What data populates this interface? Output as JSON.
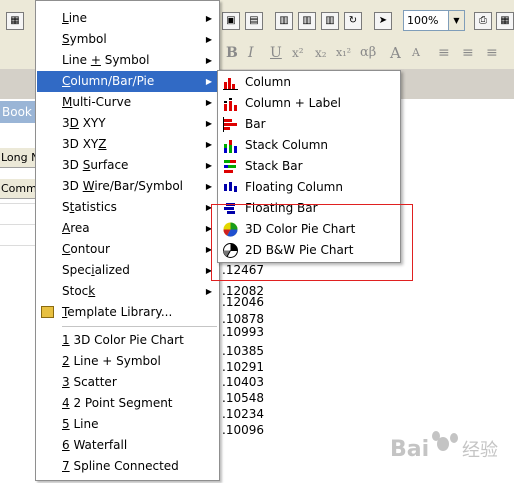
{
  "toolbar": {
    "zoom_value": "100%",
    "format_glyphs": [
      "B",
      "I",
      "U",
      "x²",
      "x₂",
      "x₁²",
      "αβ",
      "A",
      "A",
      "≡"
    ]
  },
  "worksheet": {
    "tab_label": "Book",
    "column_headers": [
      "Long N",
      "Comm"
    ],
    "cell_values": [
      ".12467",
      ".12082",
      ".12046",
      ".10878",
      ".10993",
      ".10385",
      ".10291",
      ".10403",
      ".10548",
      ".10234",
      ".10096"
    ]
  },
  "main_menu": {
    "items": [
      {
        "label": "Line",
        "mnemonic_index": 0,
        "has_submenu": true
      },
      {
        "label": "Symbol",
        "mnemonic_index": 0,
        "has_submenu": true
      },
      {
        "label": "Line + Symbol",
        "mnemonic_index": 5,
        "has_submenu": true
      },
      {
        "label": "Column/Bar/Pie",
        "mnemonic_index": 0,
        "has_submenu": true,
        "selected": true
      },
      {
        "label": "Multi-Curve",
        "mnemonic_index": 0,
        "has_submenu": true
      },
      {
        "label": "3D XYY",
        "mnemonic_index": 1,
        "has_submenu": true
      },
      {
        "label": "3D XYZ",
        "mnemonic_index": 5,
        "has_submenu": true
      },
      {
        "label": "3D Surface",
        "mnemonic_index": 3,
        "has_submenu": true
      },
      {
        "label": "3D Wire/Bar/Symbol",
        "mnemonic_index": 3,
        "has_submenu": true
      },
      {
        "label": "Statistics",
        "mnemonic_index": 1,
        "has_submenu": true
      },
      {
        "label": "Area",
        "mnemonic_index": 0,
        "has_submenu": true
      },
      {
        "label": "Contour",
        "mnemonic_index": 0,
        "has_submenu": true
      },
      {
        "label": "Specialized",
        "mnemonic_index": 4,
        "has_submenu": true
      },
      {
        "label": "Stock",
        "mnemonic_index": 4,
        "has_submenu": true
      },
      {
        "label": "Template Library...",
        "mnemonic_index": 0,
        "has_submenu": false
      }
    ],
    "recent_items": [
      {
        "label": "1 3D Color Pie Chart"
      },
      {
        "label": "2 Line + Symbol"
      },
      {
        "label": "3 Scatter"
      },
      {
        "label": "4 2 Point Segment"
      },
      {
        "label": "5 Line"
      },
      {
        "label": "6 Waterfall"
      },
      {
        "label": "7 Spline Connected"
      }
    ]
  },
  "submenu": {
    "items": [
      {
        "label": "Column",
        "icon": "column-icon"
      },
      {
        "label": "Column + Label",
        "icon": "column-label-icon"
      },
      {
        "label": "Bar",
        "icon": "bar-icon"
      },
      {
        "label": "Stack Column",
        "icon": "stack-column-icon"
      },
      {
        "label": "Stack Bar",
        "icon": "stack-bar-icon"
      },
      {
        "label": "Floating Column",
        "icon": "floating-column-icon"
      },
      {
        "label": "Floating Bar",
        "icon": "floating-bar-icon"
      },
      {
        "label": "3D Color Pie Chart",
        "icon": "color-pie-icon"
      },
      {
        "label": "2D B&W Pie Chart",
        "icon": "bw-pie-icon"
      }
    ]
  },
  "colors": {
    "selection": "#316ac5",
    "highlight_box": "#e02020",
    "menu_bg": "#ffffff",
    "toolbar_bg": "#ece9d8"
  },
  "watermark_text": "Bai 经验"
}
